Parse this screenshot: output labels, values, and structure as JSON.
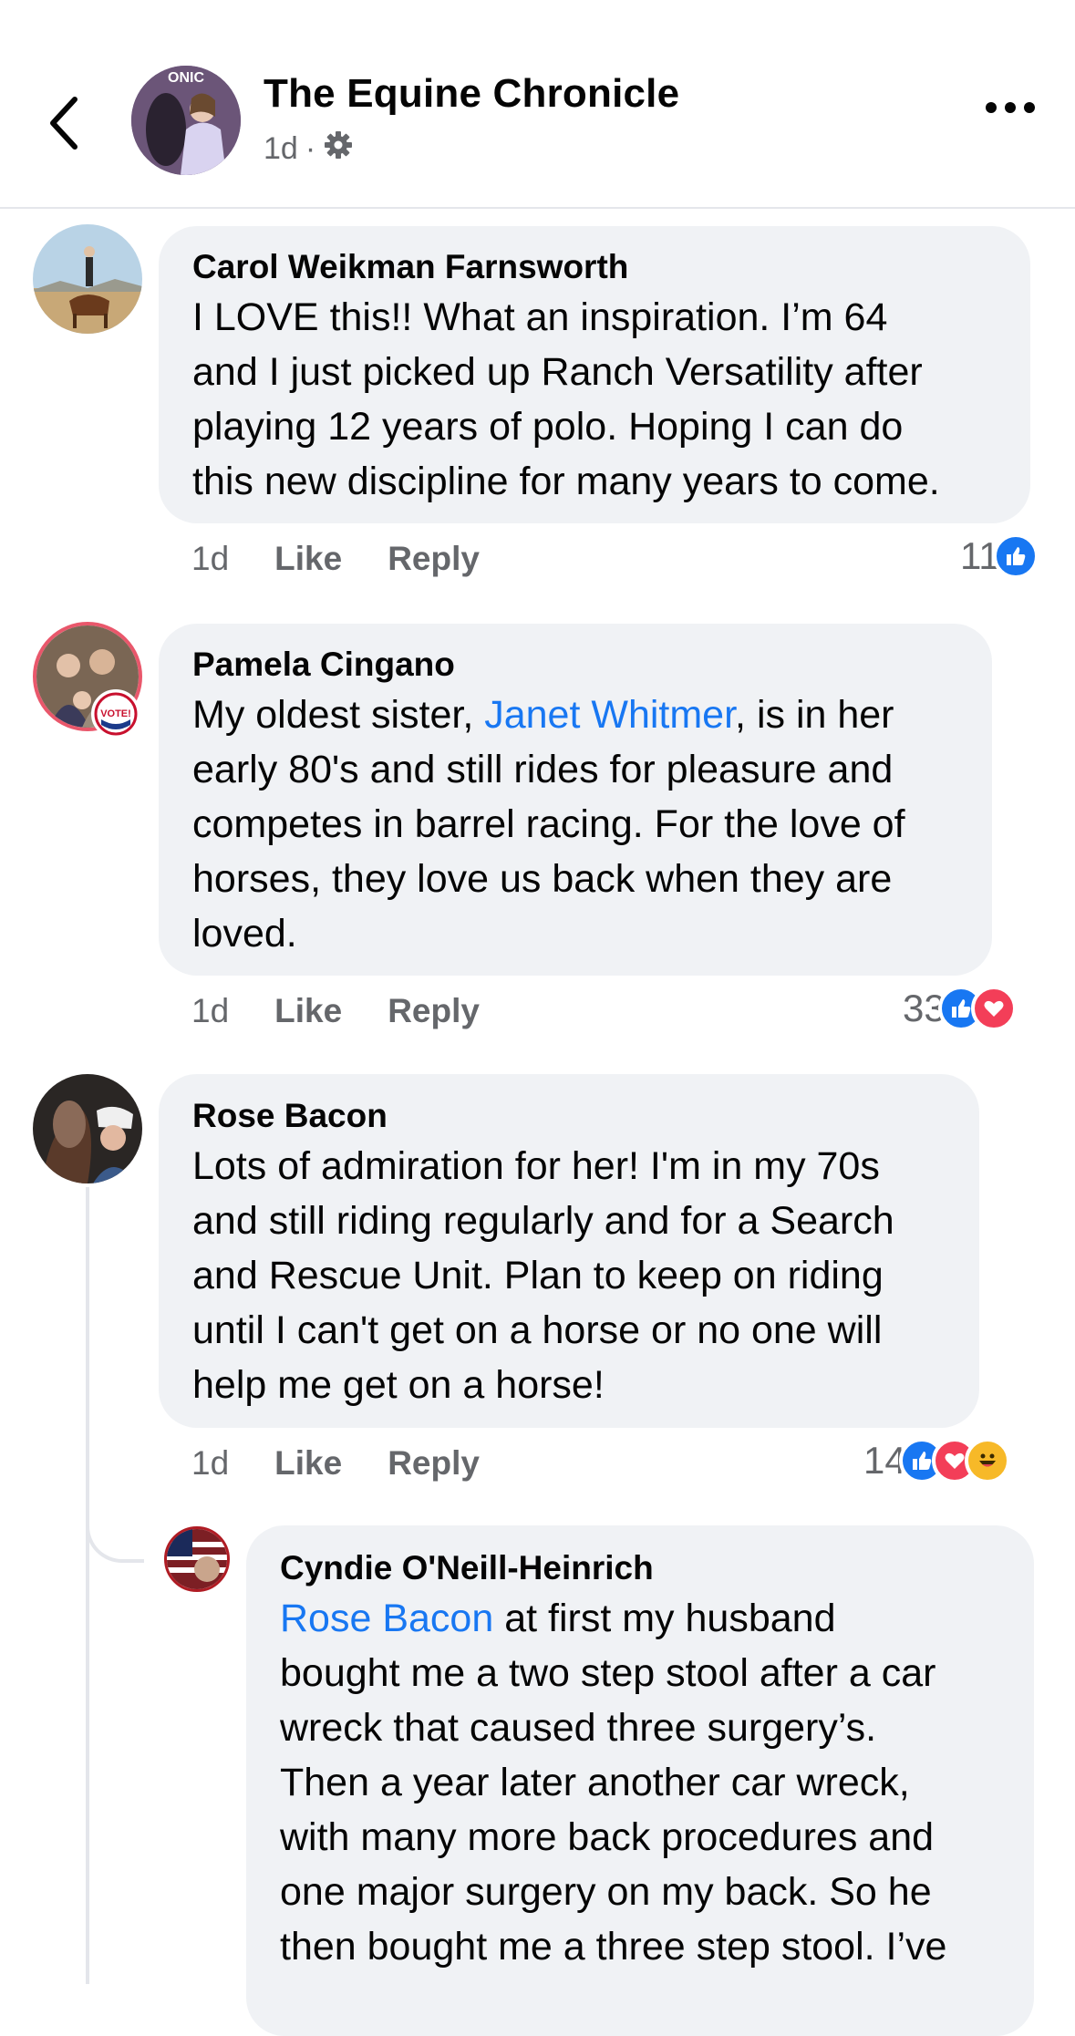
{
  "header": {
    "title": "The Equine Chronicle",
    "age": "1d",
    "separator": "·",
    "avatar_text": "ONIC"
  },
  "comments": [
    {
      "author": "Carol Weikman Farnsworth",
      "text": "I LOVE this!!  What an inspiration. I’m 64\nand I just picked up Ranch Versatility after\nplaying 12 years of polo. Hoping I can do\nthis new discipline for many years to come.",
      "time": "1d",
      "like": "Like",
      "reply": "Reply",
      "reactions": {
        "count": "11",
        "icons": [
          "like"
        ]
      }
    },
    {
      "author": "Pamela Cingano",
      "text_before": "My oldest sister, ",
      "mention": "Janet Whitmer",
      "text_after": ", is in her\nearly 80's and still rides for pleasure and\ncompetes in barrel racing. For the love of\nhorses, they love us back when they are\nloved.",
      "badge": "VOTE!",
      "time": "1d",
      "like": "Like",
      "reply": "Reply",
      "reactions": {
        "count": "33",
        "icons": [
          "like",
          "love"
        ]
      }
    },
    {
      "author": "Rose Bacon",
      "text": "Lots of admiration for her!  I'm in my 70s\nand still riding regularly and for a Search\nand Rescue Unit.  Plan to keep on riding\nuntil I can't get on a horse or no one will\nhelp me get on a horse!",
      "time": "1d",
      "like": "Like",
      "reply": "Reply",
      "reactions": {
        "count": "14",
        "icons": [
          "like",
          "love",
          "haha"
        ]
      }
    }
  ],
  "reply": {
    "author": "Cyndie O'Neill-Heinrich",
    "mention": "Rose Bacon",
    "text_after": " at first my husband\nbought me a two step stool after a car\nwreck that caused three surgery’s.\nThen a year later another car wreck,\nwith many more back procedures and\none major surgery on my back. So he\nthen bought me a three step stool. I’ve"
  },
  "colors": {
    "like": "#1877f2",
    "love": "#f33e58",
    "haha": "#f7b928",
    "link": "#1877f2",
    "bubble": "#f0f2f5"
  },
  "icons": [
    "back-chevron-icon",
    "gear-icon",
    "more-dots-icon",
    "like-reaction-icon",
    "love-reaction-icon",
    "haha-reaction-icon"
  ]
}
